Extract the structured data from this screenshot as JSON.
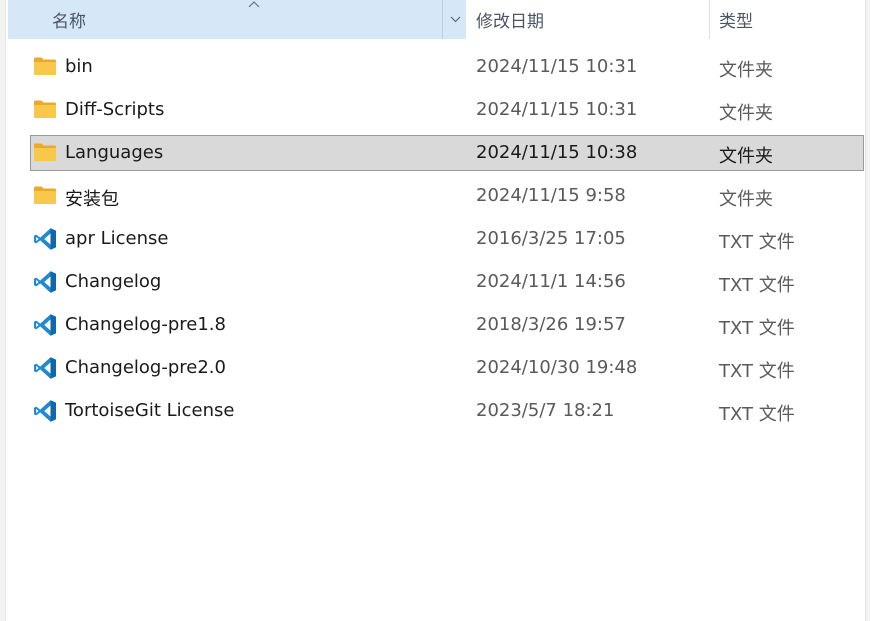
{
  "columns": {
    "name": "名称",
    "date_modified": "修改日期",
    "type": "类型"
  },
  "files": [
    {
      "name": "bin",
      "date": "2024/11/15 10:31",
      "type": "文件夹",
      "icon": "folder-icon"
    },
    {
      "name": "Diff-Scripts",
      "date": "2024/11/15 10:31",
      "type": "文件夹",
      "icon": "folder-icon"
    },
    {
      "name": "Languages",
      "date": "2024/11/15 10:38",
      "type": "文件夹",
      "icon": "folder-icon",
      "selected": true
    },
    {
      "name": "安装包",
      "date": "2024/11/15 9:58",
      "type": "文件夹",
      "icon": "folder-icon"
    },
    {
      "name": "apr License",
      "date": "2016/3/25 17:05",
      "type": "TXT 文件",
      "icon": "vscode-file-icon"
    },
    {
      "name": "Changelog",
      "date": "2024/11/1 14:56",
      "type": "TXT 文件",
      "icon": "vscode-file-icon"
    },
    {
      "name": "Changelog-pre1.8",
      "date": "2018/3/26 19:57",
      "type": "TXT 文件",
      "icon": "vscode-file-icon"
    },
    {
      "name": "Changelog-pre2.0",
      "date": "2024/10/30 19:48",
      "type": "TXT 文件",
      "icon": "vscode-file-icon"
    },
    {
      "name": "TortoiseGit License",
      "date": "2023/5/7 18:21",
      "type": "TXT 文件",
      "icon": "vscode-file-icon"
    }
  ],
  "colors": {
    "header_active": "#d6e8f8",
    "selected_row": "#d9d9d9",
    "folder": "#f6c244",
    "vscode_blue": "#1f8ad2"
  }
}
